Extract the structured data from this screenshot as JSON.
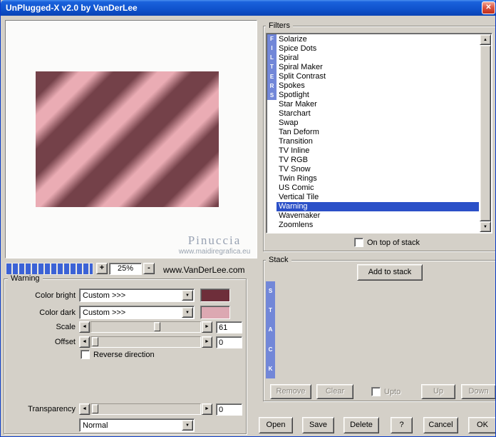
{
  "window": {
    "title": "UnPlugged-X v2.0 by VanDerLee"
  },
  "icons": {
    "close": "✕",
    "dropdown": "▼",
    "arrow_left": "◄",
    "arrow_right": "►",
    "scroll_up": "▲",
    "scroll_down": "▼"
  },
  "preview": {
    "zoom_in": "+",
    "zoom_out": "-",
    "zoom_value": "25%",
    "website": "www.VanDerLee.com",
    "watermark_name": "Pinuccia",
    "watermark_url": "www.maidiregrafica.eu"
  },
  "filters": {
    "group_label": "Filters",
    "side_label": "FILTERS",
    "selected": "Warning",
    "on_top_label": "On top of stack",
    "items": [
      "Solarize",
      "Spice Dots",
      "Spiral",
      "Spiral Maker",
      "Split Contrast",
      "Spokes",
      "Spotlight",
      "Star Maker",
      "Starchart",
      "Swap",
      "Tan Deform",
      "Transition",
      "TV Inline",
      "TV RGB",
      "TV Snow",
      "Twin Rings",
      "US Comic",
      "Vertical Tile",
      "Warning",
      "Wavemaker",
      "Zoomlens"
    ]
  },
  "warning_group": {
    "label": "Warning",
    "color_bright_label": "Color bright",
    "color_bright_value": "Custom >>>",
    "color_bright_hex": "#6e2e3a",
    "color_dark_label": "Color dark",
    "color_dark_value": "Custom >>>",
    "color_dark_hex": "#dca8b2",
    "scale_label": "Scale",
    "scale_value": "61",
    "offset_label": "Offset",
    "offset_value": "0",
    "reverse_label": "Reverse direction",
    "transparency_label": "Transparency",
    "transparency_value": "0",
    "blend_mode_value": "Normal"
  },
  "stack": {
    "group_label": "Stack",
    "side_label": "STACK",
    "add_label": "Add to stack",
    "remove_label": "Remove",
    "clear_label": "Clear",
    "upto_label": "Upto",
    "up_label": "Up",
    "down_label": "Down"
  },
  "buttons": {
    "open": "Open",
    "save": "Save",
    "delete": "Delete",
    "help": "?",
    "cancel": "Cancel",
    "ok": "OK"
  },
  "colors": {
    "selection": "#2b50c8",
    "vertical_bar": "#7287d8",
    "progress": "#3b62d6",
    "progress_gap": "#eae7e0",
    "stripe_light": "#eaacb4",
    "stripe_dark": "#744149",
    "titlebar": "#1055d0"
  }
}
